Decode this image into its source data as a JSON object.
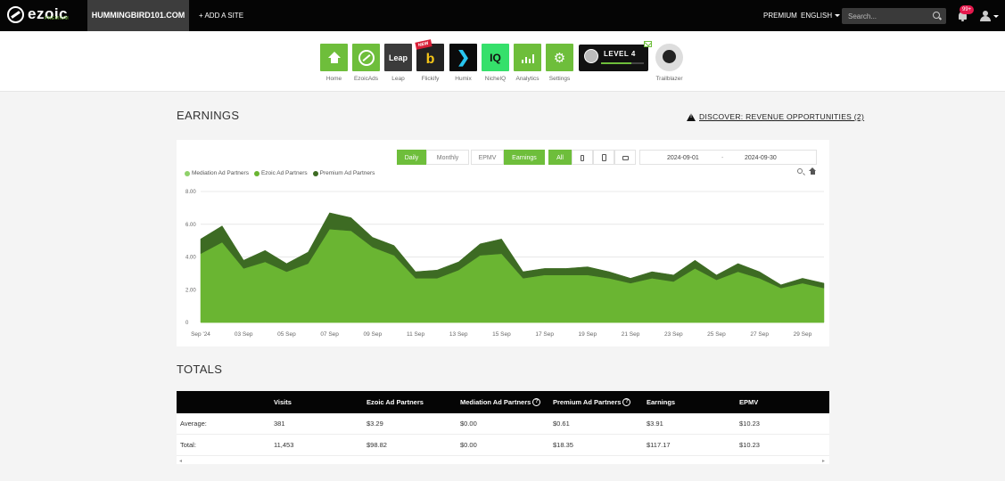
{
  "topbar": {
    "logo": "ezoic",
    "logo_sub": "PREMIUM",
    "site": "HUMMINGBIRD101.COM",
    "add_site": "+ ADD A SITE",
    "premium": "PREMIUM",
    "language": "ENGLISH",
    "search_placeholder": "Search...",
    "notifications": "99+"
  },
  "apps": [
    {
      "label": "Home",
      "color": "#6ebe3b"
    },
    {
      "label": "EzoicAds",
      "color": "#6ebe3b"
    },
    {
      "label": "Leap",
      "color": "#3b3b3b",
      "text": "Leap"
    },
    {
      "label": "Flickify",
      "color": "#222222",
      "ribbon": "NEW"
    },
    {
      "label": "Humix",
      "color": "#0b0b0b"
    },
    {
      "label": "NicheIQ",
      "color": "#35e06b",
      "text": "IQ"
    },
    {
      "label": "Analytics",
      "color": "#6ebe3b"
    },
    {
      "label": "Settings",
      "color": "#6ebe3b"
    }
  ],
  "level": {
    "text": "LEVEL 4",
    "progress": 0.7
  },
  "trailblazer": "Trailblazer",
  "earnings": {
    "title": "EARNINGS",
    "discover": "DISCOVER: REVENUE OPPORTUNITIES (2)",
    "buttons": {
      "daily": "Daily",
      "monthly": "Monthly",
      "epmv": "EPMV",
      "earnings": "Earnings",
      "all": "All"
    },
    "date_from": "2024-09-01",
    "date_sep": "-",
    "date_to": "2024-09-30"
  },
  "chart_data": {
    "type": "area",
    "stacked": true,
    "x": [
      "Sep '24",
      "02 Sep",
      "03 Sep",
      "04 Sep",
      "05 Sep",
      "06 Sep",
      "07 Sep",
      "08 Sep",
      "09 Sep",
      "10 Sep",
      "11 Sep",
      "12 Sep",
      "13 Sep",
      "14 Sep",
      "15 Sep",
      "16 Sep",
      "17 Sep",
      "18 Sep",
      "19 Sep",
      "20 Sep",
      "21 Sep",
      "22 Sep",
      "23 Sep",
      "24 Sep",
      "25 Sep",
      "26 Sep",
      "27 Sep",
      "28 Sep",
      "29 Sep",
      "30 Sep"
    ],
    "xticks": [
      "Sep '24",
      "03 Sep",
      "05 Sep",
      "07 Sep",
      "09 Sep",
      "11 Sep",
      "13 Sep",
      "15 Sep",
      "17 Sep",
      "19 Sep",
      "21 Sep",
      "23 Sep",
      "25 Sep",
      "27 Sep",
      "29 Sep"
    ],
    "yticks": [
      "0",
      "2.00",
      "4.00",
      "6.00",
      "8.00"
    ],
    "ylim": [
      0,
      8
    ],
    "grid": true,
    "legend_position": "top-left",
    "series": [
      {
        "name": "Mediation Ad Partners",
        "color": "#8fd16a",
        "values": [
          0,
          0,
          0,
          0,
          0,
          0,
          0,
          0,
          0,
          0,
          0,
          0,
          0,
          0,
          0,
          0,
          0,
          0,
          0,
          0,
          0,
          0,
          0,
          0,
          0,
          0,
          0,
          0,
          0,
          0
        ]
      },
      {
        "name": "Ezoic Ad Partners",
        "color": "#6ab532",
        "values": [
          4.2,
          4.9,
          3.3,
          3.7,
          3.1,
          3.6,
          5.7,
          5.6,
          4.6,
          4.1,
          2.7,
          2.7,
          3.2,
          4.1,
          4.2,
          2.7,
          2.9,
          2.9,
          2.9,
          2.7,
          2.4,
          2.7,
          2.5,
          3.3,
          2.6,
          3.1,
          2.7,
          2.1,
          2.4,
          2.1
        ]
      },
      {
        "name": "Premium Ad Partners",
        "color": "#3d6b23",
        "values": [
          0.9,
          1.0,
          0.5,
          0.7,
          0.5,
          0.7,
          1.0,
          0.8,
          0.6,
          0.6,
          0.4,
          0.5,
          0.5,
          0.7,
          0.9,
          0.4,
          0.4,
          0.4,
          0.5,
          0.4,
          0.3,
          0.4,
          0.4,
          0.5,
          0.3,
          0.5,
          0.4,
          0.2,
          0.3,
          0.3
        ]
      }
    ]
  },
  "totals": {
    "title": "TOTALS",
    "headers": [
      "",
      "Visits",
      "Ezoic Ad Partners",
      "Mediation Ad Partners",
      "Premium Ad Partners",
      "Earnings",
      "EPMV"
    ],
    "rows": [
      [
        "Average:",
        "381",
        "$3.29",
        "$0.00",
        "$0.61",
        "$3.91",
        "$10.23"
      ],
      [
        "Total:",
        "11,453",
        "$98.82",
        "$0.00",
        "$18.35",
        "$117.17",
        "$10.23"
      ]
    ]
  }
}
